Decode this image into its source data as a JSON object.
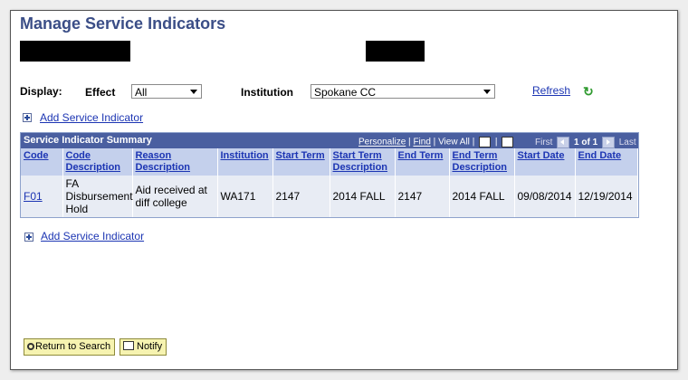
{
  "page": {
    "title": "Manage Service Indicators"
  },
  "filters": {
    "display_label": "Display:",
    "effect_label": "Effect",
    "effect_value": "All",
    "institution_label": "Institution",
    "institution_value": "Spokane CC",
    "refresh_label": "Refresh"
  },
  "add_link_label": "Add Service Indicator",
  "grid": {
    "title": "Service Indicator Summary",
    "tools": {
      "personalize": "Personalize",
      "find": "Find",
      "view_all": "View All",
      "sep": "|"
    },
    "nav": {
      "first": "First",
      "range": "1 of 1",
      "last": "Last"
    },
    "columns": [
      "Code",
      "Code Description",
      "Reason Description",
      "Institution",
      "Start Term",
      "Start Term Description",
      "End Term",
      "End Term Description",
      "Start Date",
      "End Date"
    ],
    "rows": [
      [
        "F01",
        "FA Disbursement Hold",
        "Aid received at diff college",
        "WA171",
        "2147",
        "2014 FALL",
        "2147",
        "2014 FALL",
        "09/08/2014",
        "12/19/2014"
      ]
    ]
  },
  "buttons": {
    "return_to_search": "Return to Search",
    "notify": "Notify"
  },
  "colors": {
    "title": "#3b4e87",
    "grid_header": "#4a5fa0",
    "column_header": "#c4d0ec",
    "link": "#1c35b3",
    "button": "#f6f3b0"
  },
  "icons": {
    "add": "plus-icon",
    "refresh": "refresh-icon",
    "return": "magnifier-icon",
    "notify": "notify-icon"
  }
}
